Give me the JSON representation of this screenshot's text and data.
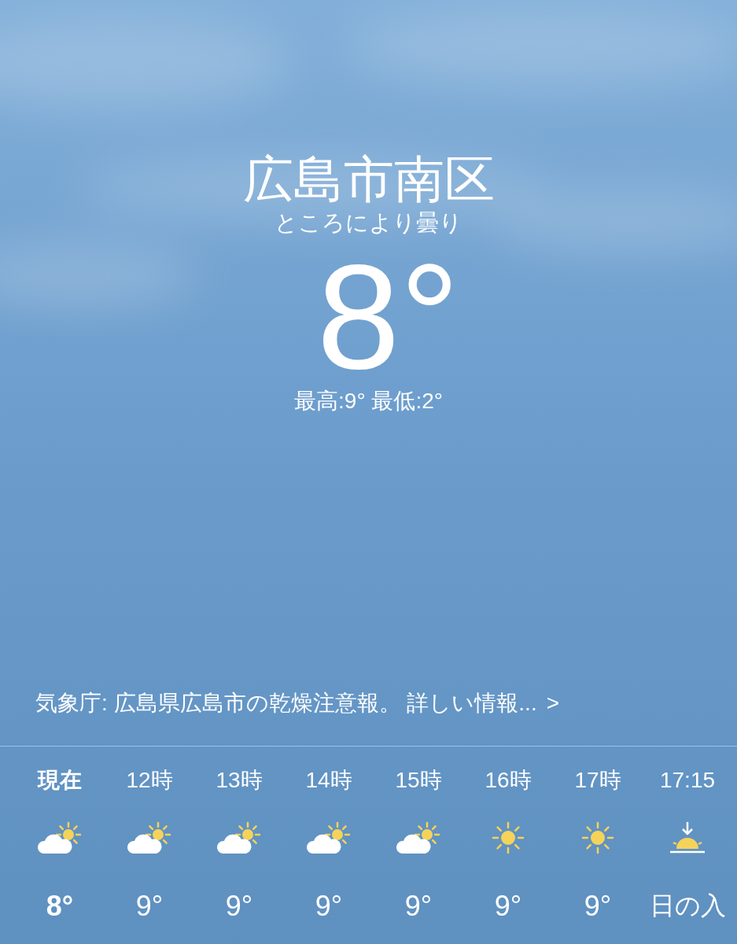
{
  "location": "広島市南区",
  "condition": "ところにより曇り",
  "temperature": "8°",
  "high_low": "最高:9° 最低:2°",
  "alert": {
    "text": "気象庁: 広島県広島市の乾燥注意報。 詳しい情報...",
    "chevron": ">"
  },
  "hourly": [
    {
      "time": "現在",
      "kind": "partly_cloudy",
      "temp": "8°",
      "selected": true
    },
    {
      "time": "12時",
      "kind": "partly_cloudy",
      "temp": "9°",
      "selected": false
    },
    {
      "time": "13時",
      "kind": "partly_cloudy",
      "temp": "9°",
      "selected": false
    },
    {
      "time": "14時",
      "kind": "partly_cloudy",
      "temp": "9°",
      "selected": false
    },
    {
      "time": "15時",
      "kind": "partly_cloudy",
      "temp": "9°",
      "selected": false
    },
    {
      "time": "16時",
      "kind": "sunny",
      "temp": "9°",
      "selected": false
    },
    {
      "time": "17時",
      "kind": "sunny",
      "temp": "9°",
      "selected": false
    },
    {
      "time": "17:15",
      "kind": "sunset",
      "temp": "日の入",
      "selected": false
    }
  ]
}
